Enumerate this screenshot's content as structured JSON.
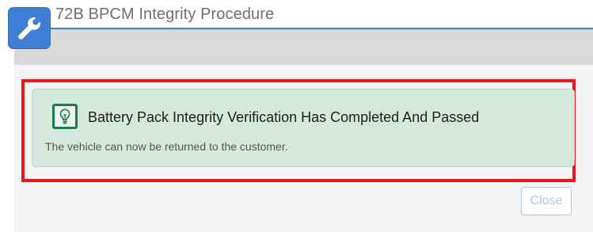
{
  "window": {
    "title": "72B BPCM Integrity Procedure",
    "app_icon": "wrench-icon",
    "accent_color": "#3f7fd6"
  },
  "alert": {
    "icon": "lightbulb-icon",
    "title": "Battery Pack Integrity Verification Has Completed And Passed",
    "message": "The vehicle can now be returned to the customer.",
    "background_color": "#d5e8de",
    "icon_color": "#1f7a4a"
  },
  "highlight_color": "#e8171a",
  "footer": {
    "close_label": "Close"
  }
}
